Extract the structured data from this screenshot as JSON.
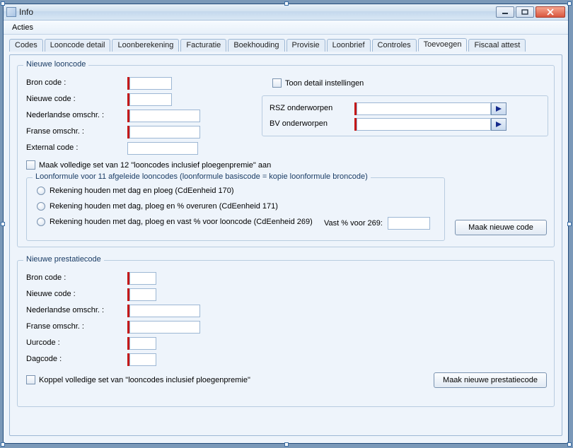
{
  "window": {
    "title": "Info"
  },
  "menu": {
    "acties": "Acties"
  },
  "tabs": [
    "Codes",
    "Looncode detail",
    "Loonberekening",
    "Facturatie",
    "Boekhouding",
    "Provisie",
    "Loonbrief",
    "Controles",
    "Toevoegen",
    "Fiscaal attest"
  ],
  "active_tab": 8,
  "group1": {
    "legend": "Nieuwe looncode",
    "bron_code": "Bron code :",
    "nieuwe_code": "Nieuwe code :",
    "ned_omschr": "Nederlandse omschr. :",
    "fra_omschr": "Franse omschr. :",
    "ext_code": "External code :",
    "toon_detail": "Toon detail instellingen",
    "rsz": "RSZ onderworpen",
    "bv": "BV onderworpen",
    "chk_set": "Maak volledige set van 12 \"looncodes inclusief ploegenpremie\" aan",
    "sub_legend": "Loonformule voor 11 afgeleide looncodes (loonformule basiscode = kopie loonformule broncode)",
    "r1": "Rekening houden met dag en ploeg (CdEenheid 170)",
    "r2": "Rekening houden met dag, ploeg en % overuren (CdEenheid 171)",
    "r3": "Rekening houden met dag, ploeg en vast % voor looncode (CdEenheid 269)",
    "vast_lbl": "Vast % voor 269:",
    "btn": "Maak nieuwe code"
  },
  "group2": {
    "legend": "Nieuwe prestatiecode",
    "bron_code": "Bron code :",
    "nieuwe_code": "Nieuwe code :",
    "ned_omschr": "Nederlandse omschr. :",
    "fra_omschr": "Franse omschr. :",
    "uurcode": "Uurcode :",
    "dagcode": "Dagcode :",
    "chk_koppel": "Koppel volledige set van \"looncodes inclusief ploegenpremie\"",
    "btn": "Maak nieuwe prestatiecode"
  }
}
